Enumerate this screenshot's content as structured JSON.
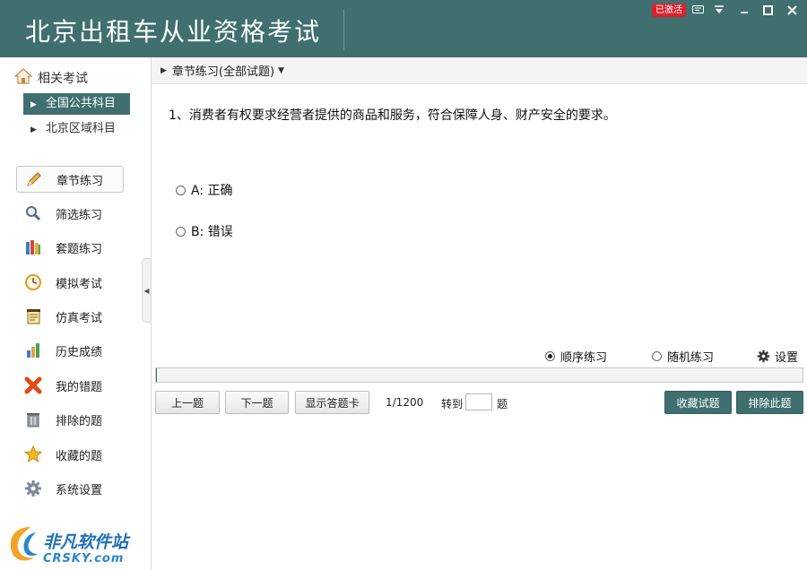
{
  "app": {
    "title": "北京出租车从业资格考试",
    "badge": "已激活"
  },
  "sidebar": {
    "related_label": "相关考试",
    "subjects": [
      {
        "label": "全国公共科目",
        "active": true
      },
      {
        "label": "北京区域科目",
        "active": false
      }
    ],
    "menu": [
      {
        "label": "章节练习",
        "icon": "pencil-icon",
        "active": true
      },
      {
        "label": "筛选练习",
        "icon": "magnifier-icon",
        "active": false
      },
      {
        "label": "套题练习",
        "icon": "books-icon",
        "active": false
      },
      {
        "label": "模拟考试",
        "icon": "clock-icon",
        "active": false
      },
      {
        "label": "仿真考试",
        "icon": "notepad-icon",
        "active": false
      },
      {
        "label": "历史成绩",
        "icon": "bar-chart-icon",
        "active": false
      },
      {
        "label": "我的错题",
        "icon": "red-x-icon",
        "active": false
      },
      {
        "label": "排除的题",
        "icon": "trash-icon",
        "active": false
      },
      {
        "label": "收藏的题",
        "icon": "star-icon",
        "active": false
      },
      {
        "label": "系统设置",
        "icon": "gear-icon",
        "active": false
      }
    ]
  },
  "breadcrumb": {
    "label": "章节练习(全部试题)"
  },
  "question": {
    "text": "1、消费者有权要求经营者提供的商品和服务，符合保障人身、财产安全的要求。",
    "options": [
      {
        "label": "A: 正确"
      },
      {
        "label": "B: 错误"
      }
    ]
  },
  "mode": {
    "sequential": "顺序练习",
    "random": "随机练习",
    "settings": "设置",
    "selected": "sequential"
  },
  "progress": {
    "fraction": 0.001
  },
  "toolbar": {
    "prev": "上一题",
    "next": "下一题",
    "show_card": "显示答题卡",
    "counter": "1/1200",
    "goto_label": "转到",
    "goto_value": "",
    "goto_suffix": "题",
    "favorite": "收藏试题",
    "exclude": "排除此题"
  },
  "logo": {
    "cn": "非凡软件站",
    "en": "CRSKY.com"
  },
  "colors": {
    "accent": "#3f6f6f",
    "badge": "#d9232e"
  }
}
